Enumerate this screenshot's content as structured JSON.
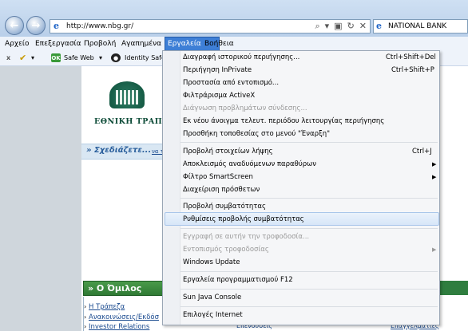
{
  "browser": {
    "url": "http://www.nbg.gr/",
    "search_text": "NATIONAL BANK"
  },
  "menubar": {
    "items": [
      "Αρχείο",
      "Επεξεργασία",
      "Προβολή",
      "Αγαπημένα",
      "Εργαλεία",
      "Βοήθεια"
    ]
  },
  "toolbar": {
    "close_label": "x",
    "safe_web": "Safe Web",
    "identity_safe": "Identity Safe"
  },
  "page": {
    "logo_text": "ΕΘΝΙΚΗ ΤΡΑΠΕΖ",
    "plan_text": "» Σχεδιάζετε...",
    "plan_link_fragment": "να τ",
    "group_title": "» Ο Όμιλος",
    "group_links": [
      "Η Τράπεζα",
      "Ανακοινώσεις/Εκδόσ",
      "Investor Relations"
    ],
    "mid_link": "Επενδύσεις",
    "right_link": "Επαγγελματίες"
  },
  "tools_menu": {
    "items": [
      {
        "label": "Διαγραφή ιστορικού περιήγησης...",
        "shortcut": "Ctrl+Shift+Del",
        "disabled": false
      },
      {
        "label": "Περιήγηση InPrivate",
        "shortcut": "Ctrl+Shift+P",
        "disabled": false
      },
      {
        "label": "Προστασία από εντοπισμό...",
        "shortcut": "",
        "disabled": false
      },
      {
        "label": "Φιλτράρισμα ActiveX",
        "shortcut": "",
        "disabled": false
      },
      {
        "label": "Διάγνωση προβλημάτων σύνδεσης...",
        "shortcut": "",
        "disabled": true
      },
      {
        "label": "Εκ νέου άνοιγμα τελευτ. περιόδου λειτουργίας περιήγησης",
        "shortcut": "",
        "disabled": false
      },
      {
        "label": "Προσθήκη τοποθεσίας στο μενού \"Έναρξη\"",
        "shortcut": "",
        "disabled": false
      },
      {
        "label": "Προβολή στοιχείων λήψης",
        "shortcut": "Ctrl+J",
        "disabled": false
      },
      {
        "label": "Αποκλεισμός αναδυόμενων παραθύρων",
        "shortcut": "",
        "disabled": false,
        "submenu": true
      },
      {
        "label": "Φίλτρο SmartScreen",
        "shortcut": "",
        "disabled": false,
        "submenu": true
      },
      {
        "label": "Διαχείριση πρόσθετων",
        "shortcut": "",
        "disabled": false
      },
      {
        "label": "Προβολή συμβατότητας",
        "shortcut": "",
        "disabled": false
      },
      {
        "label": "Ρυθμίσεις προβολής συμβατότητας",
        "shortcut": "",
        "disabled": false,
        "highlighted": true
      },
      {
        "label": "Εγγραφή σε αυτήν την τροφοδοσία...",
        "shortcut": "",
        "disabled": true
      },
      {
        "label": "Εντοπισμός τροφοδοσίας",
        "shortcut": "",
        "disabled": true,
        "submenu": true
      },
      {
        "label": "Windows Update",
        "shortcut": "",
        "disabled": false
      },
      {
        "label": "Εργαλεία προγραμματισμού F12",
        "shortcut": "",
        "disabled": false
      },
      {
        "label": "Sun Java Console",
        "shortcut": "",
        "disabled": false
      },
      {
        "label": "Επιλογές Internet",
        "shortcut": "",
        "disabled": false
      }
    ]
  }
}
